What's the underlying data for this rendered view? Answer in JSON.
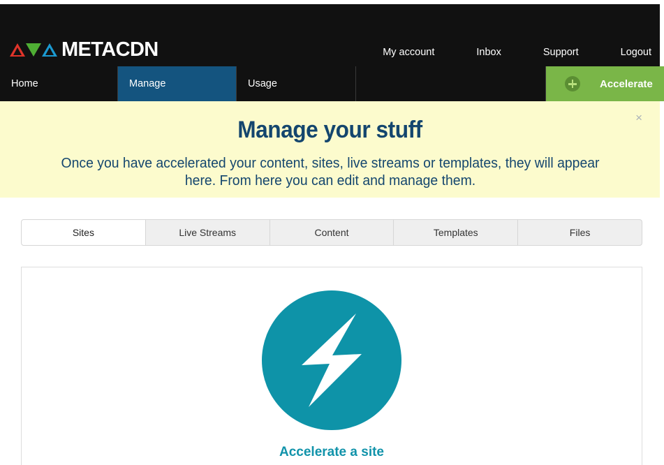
{
  "header": {
    "logo_text": "METACDN",
    "logo_marks": [
      {
        "name": "triangle-up-red",
        "color": "#e0342a"
      },
      {
        "name": "triangle-down-green",
        "color": "#4fae34"
      },
      {
        "name": "triangle-up-blue",
        "color": "#1b9ad1"
      }
    ],
    "top_links": [
      {
        "label": "My account"
      },
      {
        "label": "Inbox"
      },
      {
        "label": "Support"
      },
      {
        "label": "Logout"
      }
    ]
  },
  "nav": {
    "items": [
      {
        "label": "Home",
        "active": false
      },
      {
        "label": "Manage",
        "active": true
      },
      {
        "label": "Usage",
        "active": false
      }
    ],
    "accelerate": {
      "label": "Accelerate",
      "icon": "plus-circle-icon",
      "background": "#7ab648"
    },
    "active_background": "#14547f"
  },
  "banner": {
    "title": "Manage your stuff",
    "subtitle": "Once you have accelerated your content, sites, live streams or templates, they will appear here. From here you can edit and manage them.",
    "close_icon": "×",
    "background": "#fcfbcd",
    "text_color": "#14466e"
  },
  "tabs": [
    {
      "label": "Sites",
      "active": true
    },
    {
      "label": "Live Streams",
      "active": false
    },
    {
      "label": "Content",
      "active": false
    },
    {
      "label": "Templates",
      "active": false
    },
    {
      "label": "Files",
      "active": false
    }
  ],
  "main": {
    "accelerate_tile": {
      "icon": "lightning-bolt-icon",
      "icon_background": "#0e93a8",
      "caption": "Accelerate a site",
      "caption_color": "#1193aa"
    }
  }
}
